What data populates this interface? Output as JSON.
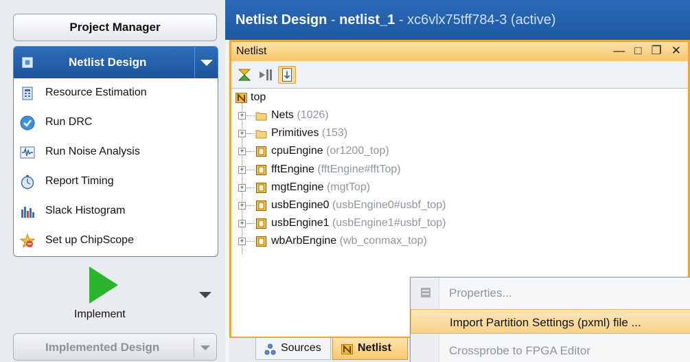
{
  "flow": {
    "project_manager": "Project Manager",
    "netlist_design": "Netlist Design",
    "items": [
      {
        "label": "Resource Estimation",
        "icon": "resource-estimation-icon"
      },
      {
        "label": "Run DRC",
        "icon": "check-circle-icon"
      },
      {
        "label": "Run Noise Analysis",
        "icon": "noise-wave-icon"
      },
      {
        "label": "Report Timing",
        "icon": "stopwatch-icon"
      },
      {
        "label": "Slack Histogram",
        "icon": "histogram-icon"
      },
      {
        "label": "Set up ChipScope",
        "icon": "chipscope-icon"
      }
    ],
    "implement": "Implement",
    "implemented_design": "Implemented Design"
  },
  "header": {
    "title": "Netlist Design",
    "sep1": " - ",
    "design": "netlist_1",
    "sep2": " - ",
    "part": "xc6vlx75tff784-3",
    "state": "(active)"
  },
  "netlist_window": {
    "title": "Netlist",
    "controls": [
      "—",
      "□",
      "❐",
      "✕"
    ],
    "root": "top",
    "rows": [
      {
        "name": "Nets",
        "sub": "(1026)",
        "type": "folder"
      },
      {
        "name": "Primitives",
        "sub": "(153)",
        "type": "folder"
      },
      {
        "name": "cpuEngine",
        "sub": "(or1200_top)",
        "type": "module"
      },
      {
        "name": "fftEngine",
        "sub": "(fftEngine#fftTop)",
        "type": "module"
      },
      {
        "name": "mgtEngine",
        "sub": "(mgtTop)",
        "type": "module"
      },
      {
        "name": "usbEngine0",
        "sub": "(usbEngine0#usbf_top)",
        "type": "module"
      },
      {
        "name": "usbEngine1",
        "sub": "(usbEngine1#usbf_top)",
        "type": "module"
      },
      {
        "name": "wbArbEngine",
        "sub": "(wb_conmax_top)",
        "type": "module"
      }
    ]
  },
  "tabs": {
    "sources": "Sources",
    "netlist": "Netlist"
  },
  "context_menu": {
    "items": [
      {
        "label": "Properties...",
        "state": "disabled"
      },
      {
        "label": "Import Partition Settings (pxml) file ...",
        "state": "hover"
      },
      {
        "label": "Crossprobe to FPGA Editor",
        "state": "disabled"
      }
    ]
  },
  "colors": {
    "accent_blue": "#1d57a2",
    "active_orange": "#f2a33a",
    "play_green": "#2bb52e"
  }
}
